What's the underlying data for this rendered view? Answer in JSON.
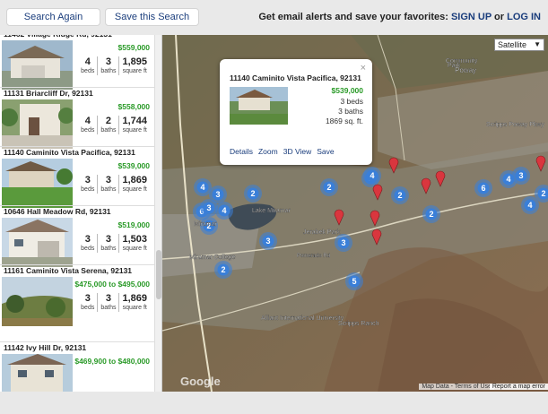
{
  "toolbar": {
    "search_again": "Search Again",
    "save_search": "Save this Search",
    "alert_text": "Get email alerts and save your favorites:",
    "sign_up": "SIGN UP",
    "or": "or",
    "log_in": "LOG IN"
  },
  "listings": [
    {
      "address": "11462 Village Ridge Rd, 92131",
      "price": "$559,000",
      "beds": "4",
      "baths": "3",
      "sqft": "1,895",
      "photo": "house-white-garage"
    },
    {
      "address": "11131 Briarcliff Dr, 92131",
      "price": "$558,000",
      "beds": "4",
      "baths": "2",
      "sqft": "1,744",
      "photo": "house-front-walk"
    },
    {
      "address": "11140 Caminito Vista Pacifica, 92131",
      "price": "$539,000",
      "beds": "3",
      "baths": "3",
      "sqft": "1,869",
      "photo": "house-lawn"
    },
    {
      "address": "10646 Hall Meadow Rd, 92131",
      "price": "$519,000",
      "beds": "3",
      "baths": "3",
      "sqft": "1,503",
      "photo": "house-garage"
    },
    {
      "address": "11161 Caminito Vista Serena, 92131",
      "price": "$475,000 to $495,000",
      "beds": "3",
      "baths": "3",
      "sqft": "1,869",
      "photo": "hillside-trees"
    },
    {
      "address": "11142 Ivy Hill Dr, 92131",
      "price": "$469,900 to $480,000",
      "beds": "",
      "baths": "",
      "sqft": "",
      "photo": "house-two-story"
    }
  ],
  "units": {
    "beds": "beds",
    "baths": "baths",
    "sqft": "square ft"
  },
  "map": {
    "map_type": "Satellite",
    "places": [
      "Poway",
      "Community",
      "Park",
      "Miramar",
      "Lake Miramar",
      "Jerabek Park",
      "Miramar College",
      "Alliant International University",
      "Scripps Ranch",
      "Scripps Poway Pkwy",
      "Pomerado Rd"
    ],
    "clusters": [
      "4",
      "3",
      "2",
      "6",
      "3",
      "4",
      "3",
      "2",
      "2",
      "5",
      "2",
      "3",
      "6",
      "4",
      "3",
      "2",
      "2",
      "5",
      "4",
      "4",
      "2"
    ],
    "google": "Google",
    "attribution": "Map Data - Terms of Use",
    "report": "Report a map error"
  },
  "popup": {
    "title": "11140 Caminito Vista Pacifica, 92131",
    "price": "$539,000",
    "beds": "3 beds",
    "baths": "3 baths",
    "sqft": "1869 sq. ft.",
    "links": [
      "Details",
      "Zoom",
      "3D View",
      "Save"
    ],
    "close": "×"
  },
  "colors": {
    "link": "#1a3d7c",
    "price": "#2a9a28",
    "cluster": "#3a7fd8",
    "pin": "#d9363e"
  }
}
